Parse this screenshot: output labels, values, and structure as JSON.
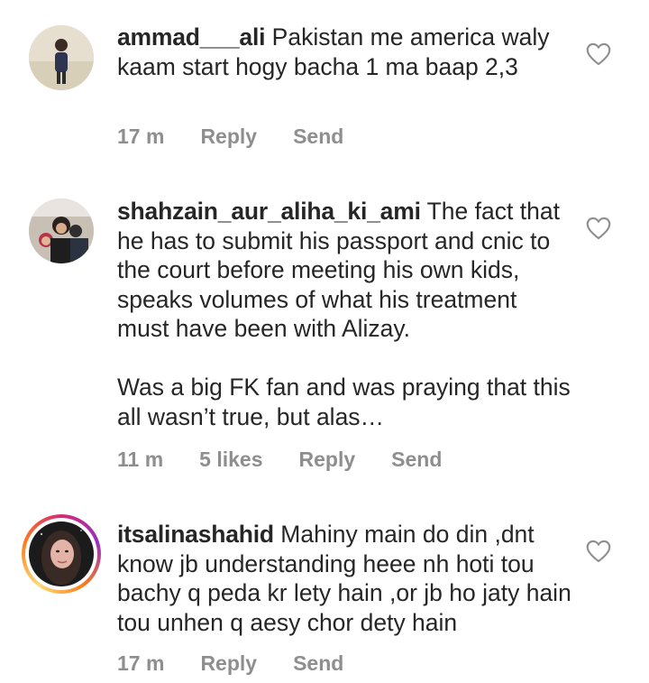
{
  "comments": [
    {
      "username": "ammad___ali",
      "text": "Pakistan me america waly kaam start hogy bacha 1 ma baap 2,3",
      "time": "17 m",
      "likes": "",
      "reply_label": "Reply",
      "send_label": "Send",
      "has_story": false
    },
    {
      "username": "shahzain_aur_aliha_ki_ami",
      "text": "The fact that he has to submit his passport and cnic to the court before meeting his own kids, speaks volumes of what his treatment must have been with Alizay.\n\nWas a big FK fan and was praying that this all wasn’t true, but alas…",
      "time": "11 m",
      "likes": "5 likes",
      "reply_label": "Reply",
      "send_label": "Send",
      "has_story": false
    },
    {
      "username": "itsalinashahid",
      "text": "Mahiny main do din ,dnt know jb understanding heee nh hoti tou bachy q peda kr lety hain ,or jb ho jaty hain tou unhen q aesy chor dety hain",
      "time": "17 m",
      "likes": "",
      "reply_label": "Reply",
      "send_label": "Send",
      "has_story": true
    }
  ],
  "icons": {
    "like": "heart-outline-icon"
  },
  "colors": {
    "text": "#262626",
    "meta": "#8e8e8e",
    "ring_start": "#d62976",
    "ring_end": "#feda75"
  }
}
